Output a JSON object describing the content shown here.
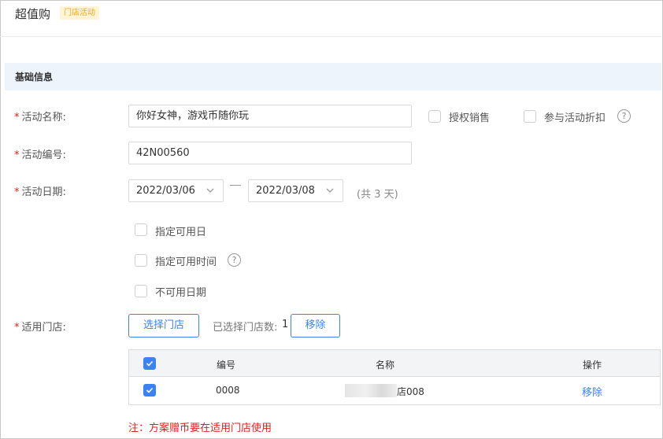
{
  "header": {
    "title": "超值购",
    "tag": "门店活动"
  },
  "section": {
    "title": "基础信息"
  },
  "form": {
    "required_mark": "*",
    "name_label": "活动名称:",
    "name_value": "你好女神，游戏币随你玩",
    "authorized_sales_label": "授权销售",
    "discount_label": "参与活动折扣",
    "code_label": "活动编号:",
    "code_value": "42N00560",
    "date_label": "活动日期:",
    "start_date": "2022/03/06",
    "end_date": "2022/03/08",
    "date_separator": "一",
    "duration": "(共  3  天)",
    "specify_days_label": "指定可用日",
    "specify_time_label": "指定可用时间",
    "unavailable_dates_label": "不可用日期",
    "stores_label": "适用门店:",
    "select_stores_button": "选择门店",
    "selected_count_label": "已选择门店数:",
    "selected_count": "1",
    "remove_button": "移除"
  },
  "table": {
    "headers": {
      "code": "编号",
      "name": "名称",
      "action": "操作"
    },
    "rows": [
      {
        "code": "0008",
        "name_suffix": "店008",
        "action": "移除"
      }
    ]
  },
  "note": "注：方案赠币要在适用门店使用",
  "colors": {
    "accent": "#3b82f6",
    "required": "#e02020",
    "tag_bg": "#fff4d6",
    "tag_text": "#f5a623"
  },
  "icons": [
    "chevron-down-icon",
    "question-circle-icon",
    "check-icon"
  ]
}
